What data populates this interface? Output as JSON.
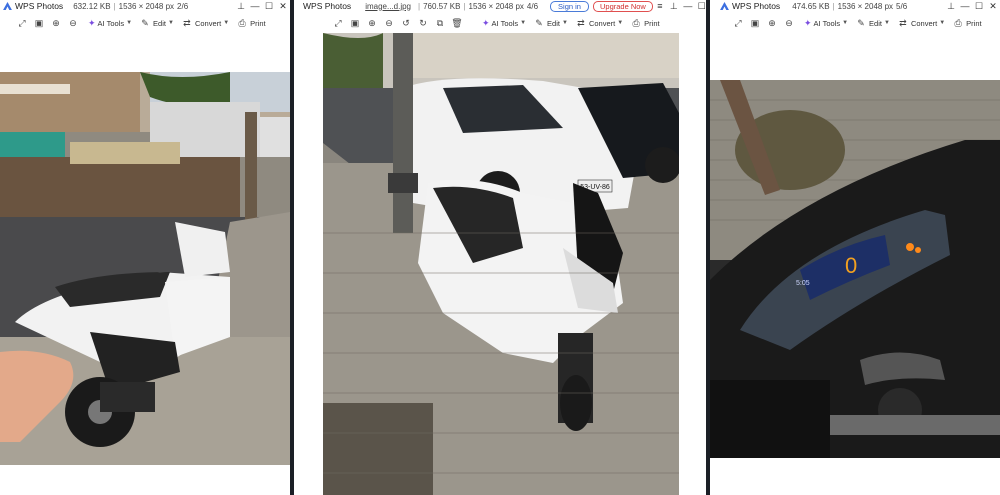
{
  "app_name": "WPS Photos",
  "windows": [
    {
      "file_meta": [
        "632.12 KB",
        "1536 × 2048 px",
        "2/6"
      ],
      "toolbar": {
        "ai_tools": "AI Tools",
        "edit": "Edit",
        "convert": "Convert",
        "print": "Print"
      }
    },
    {
      "file_name": "image...d.jpg",
      "file_meta": [
        "760.57 KB",
        "1536 × 2048 px",
        "4/6"
      ],
      "sign_in": "Sign in",
      "upgrade": "Upgrade Now",
      "toolbar": {
        "ai_tools": "AI Tools",
        "edit": "Edit",
        "convert": "Convert",
        "print": "Print"
      },
      "plate_text": "53-UV-86"
    },
    {
      "file_meta": [
        "474.65 KB",
        "1536 × 2048 px",
        "5/6"
      ],
      "toolbar": {
        "ai_tools": "AI Tools",
        "edit": "Edit",
        "convert": "Convert",
        "print": "Print"
      },
      "dash_speed": "0",
      "dash_time": "5:05"
    }
  ],
  "colors": {
    "accent_blue": "#4a7bd8",
    "upgrade_red": "#e04f4f",
    "ai_purple": "#7a4de0"
  }
}
